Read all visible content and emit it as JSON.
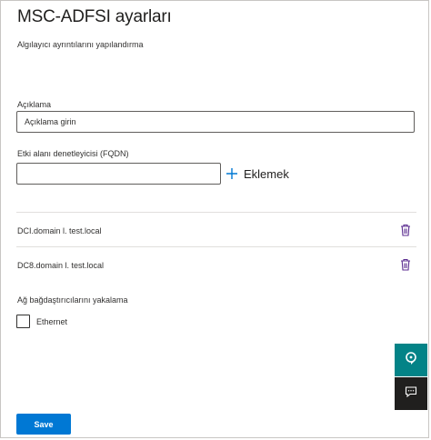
{
  "header": {
    "title": "MSC-ADFSI ayarları",
    "subtitle": "Algılayıcı ayrıntılarını yapılandırma"
  },
  "description": {
    "label": "Açıklama",
    "placeholder": "Açıklama girin"
  },
  "fqdn": {
    "label": "Etki alanı denetleyicisi (FQDN)",
    "value": "",
    "add_label": "Eklemek",
    "add_icon": "plus-icon"
  },
  "domain_controllers": [
    {
      "name": "DCI.domain l. test.local",
      "icon": "trash-icon"
    },
    {
      "name": "DC8.domain l. test.local",
      "icon": "trash-icon"
    }
  ],
  "capture": {
    "label": "Ağ bağdaştırıcılarını yakalama",
    "adapters": [
      {
        "name": "Ethernet",
        "checked": false
      }
    ]
  },
  "side_actions": {
    "help_icon": "help-chat-icon",
    "feedback_icon": "feedback-icon"
  },
  "footer": {
    "save_label": "Save"
  },
  "colors": {
    "accent": "#0078d4",
    "help_bg": "#038387",
    "feedback_bg": "#201f1e",
    "trash_icon": "#5c2e91"
  }
}
